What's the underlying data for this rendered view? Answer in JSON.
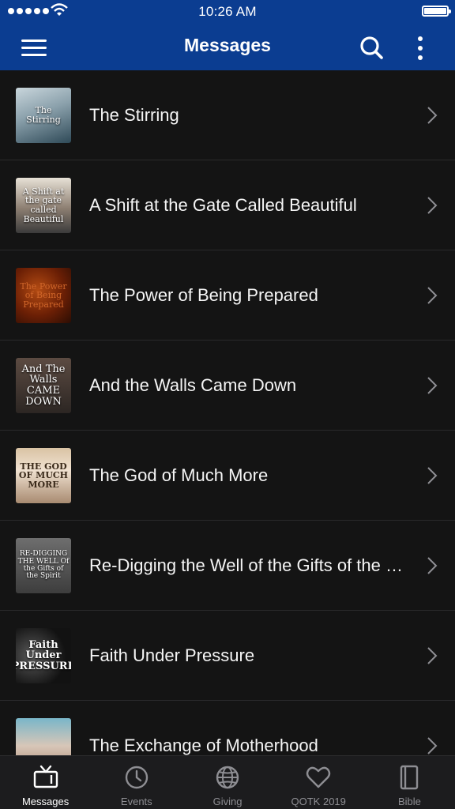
{
  "status_bar": {
    "time": "10:26 AM"
  },
  "header": {
    "title": "Messages"
  },
  "messages": [
    {
      "title": "The Stirring",
      "thumb_text": "The Stirring"
    },
    {
      "title": "A Shift at the Gate Called Beautiful",
      "thumb_text": "A Shift at the gate called Beautiful"
    },
    {
      "title": "The Power of Being Prepared",
      "thumb_text": "The Power of Being Prepared"
    },
    {
      "title": "And the Walls Came Down",
      "thumb_text": "And The Walls CAME DOWN"
    },
    {
      "title": "The God of Much More",
      "thumb_text": "THE GOD OF MUCH MORE"
    },
    {
      "title": "Re-Digging the Well of the Gifts of the Spirit",
      "thumb_text": "RE-DIGGING THE WELL Of the Gifts of the Spirit"
    },
    {
      "title": "Faith Under Pressure",
      "thumb_text": "Faith Under PRESSURE"
    },
    {
      "title": "The Exchange of Motherhood",
      "thumb_text": ""
    }
  ],
  "tabs": [
    {
      "label": "Messages",
      "icon": "tv-icon",
      "active": true
    },
    {
      "label": "Events",
      "icon": "clock-icon",
      "active": false
    },
    {
      "label": "Giving",
      "icon": "globe-icon",
      "active": false
    },
    {
      "label": "QOTK 2019",
      "icon": "heart-icon",
      "active": false
    },
    {
      "label": "Bible",
      "icon": "book-icon",
      "active": false
    }
  ],
  "colors": {
    "nav_bar": "#0b3d91",
    "background": "#141414",
    "tab_bar": "#1c1c1e",
    "tab_inactive": "#8e8e93",
    "tab_active": "#ffffff"
  }
}
